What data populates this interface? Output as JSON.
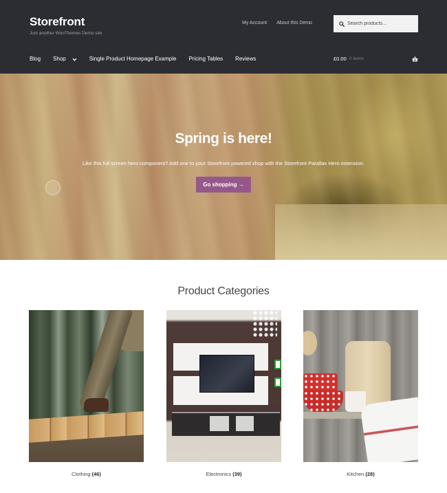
{
  "header": {
    "site_title": "Storefront",
    "site_description": "Just another WooThemes Demo site",
    "secondary_nav": [
      {
        "label": "My Account"
      },
      {
        "label": "About this Demo"
      }
    ],
    "search": {
      "placeholder": "Search products…",
      "value": "",
      "icon": "search-icon"
    },
    "primary_nav": [
      {
        "label": "Blog"
      },
      {
        "label": "Shop",
        "has_dropdown": true
      },
      {
        "label": "Single Product Homepage Example"
      },
      {
        "label": "Pricing Tables"
      },
      {
        "label": "Reviews"
      }
    ],
    "cart": {
      "amount": "£0.00",
      "count": "0 items",
      "icon": "basket-icon"
    }
  },
  "hero": {
    "title": "Spring is here!",
    "text": "Like this full screen hero component? Add one to your Storefront powered shop with the Storefront Parallax Hero extension.",
    "button_label": "Go shopping →",
    "button_color": "#96588a"
  },
  "categories": {
    "title": "Product Categories",
    "items": [
      {
        "name": "Clothing",
        "count": "(46)"
      },
      {
        "name": "Electronics",
        "count": "(39)"
      },
      {
        "name": "Kitchen",
        "count": "(28)"
      }
    ]
  },
  "colors": {
    "header_bg": "#2c2d33",
    "accent": "#96588a",
    "text": "#43454b"
  }
}
